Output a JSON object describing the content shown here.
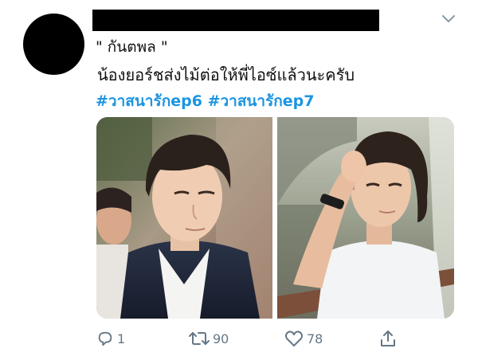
{
  "tweet": {
    "line1": "\" กันตพล \"",
    "line2": "น้องยอร์ชส่งไม้ต่อให้พี่ไอซ์แล้วนะครับ",
    "hashtags": [
      "#วาสนารักep6",
      "#วาสนารักep7"
    ]
  },
  "actions": {
    "reply_count": "1",
    "retweet_count": "90",
    "like_count": "78"
  },
  "icons": {
    "menu": "chevron-down-icon",
    "reply": "reply-icon",
    "retweet": "retweet-icon",
    "like": "heart-icon",
    "share": "share-icon"
  },
  "colors": {
    "hashtag": "#1b95e0",
    "action_gray": "#657786",
    "text": "#111111"
  }
}
